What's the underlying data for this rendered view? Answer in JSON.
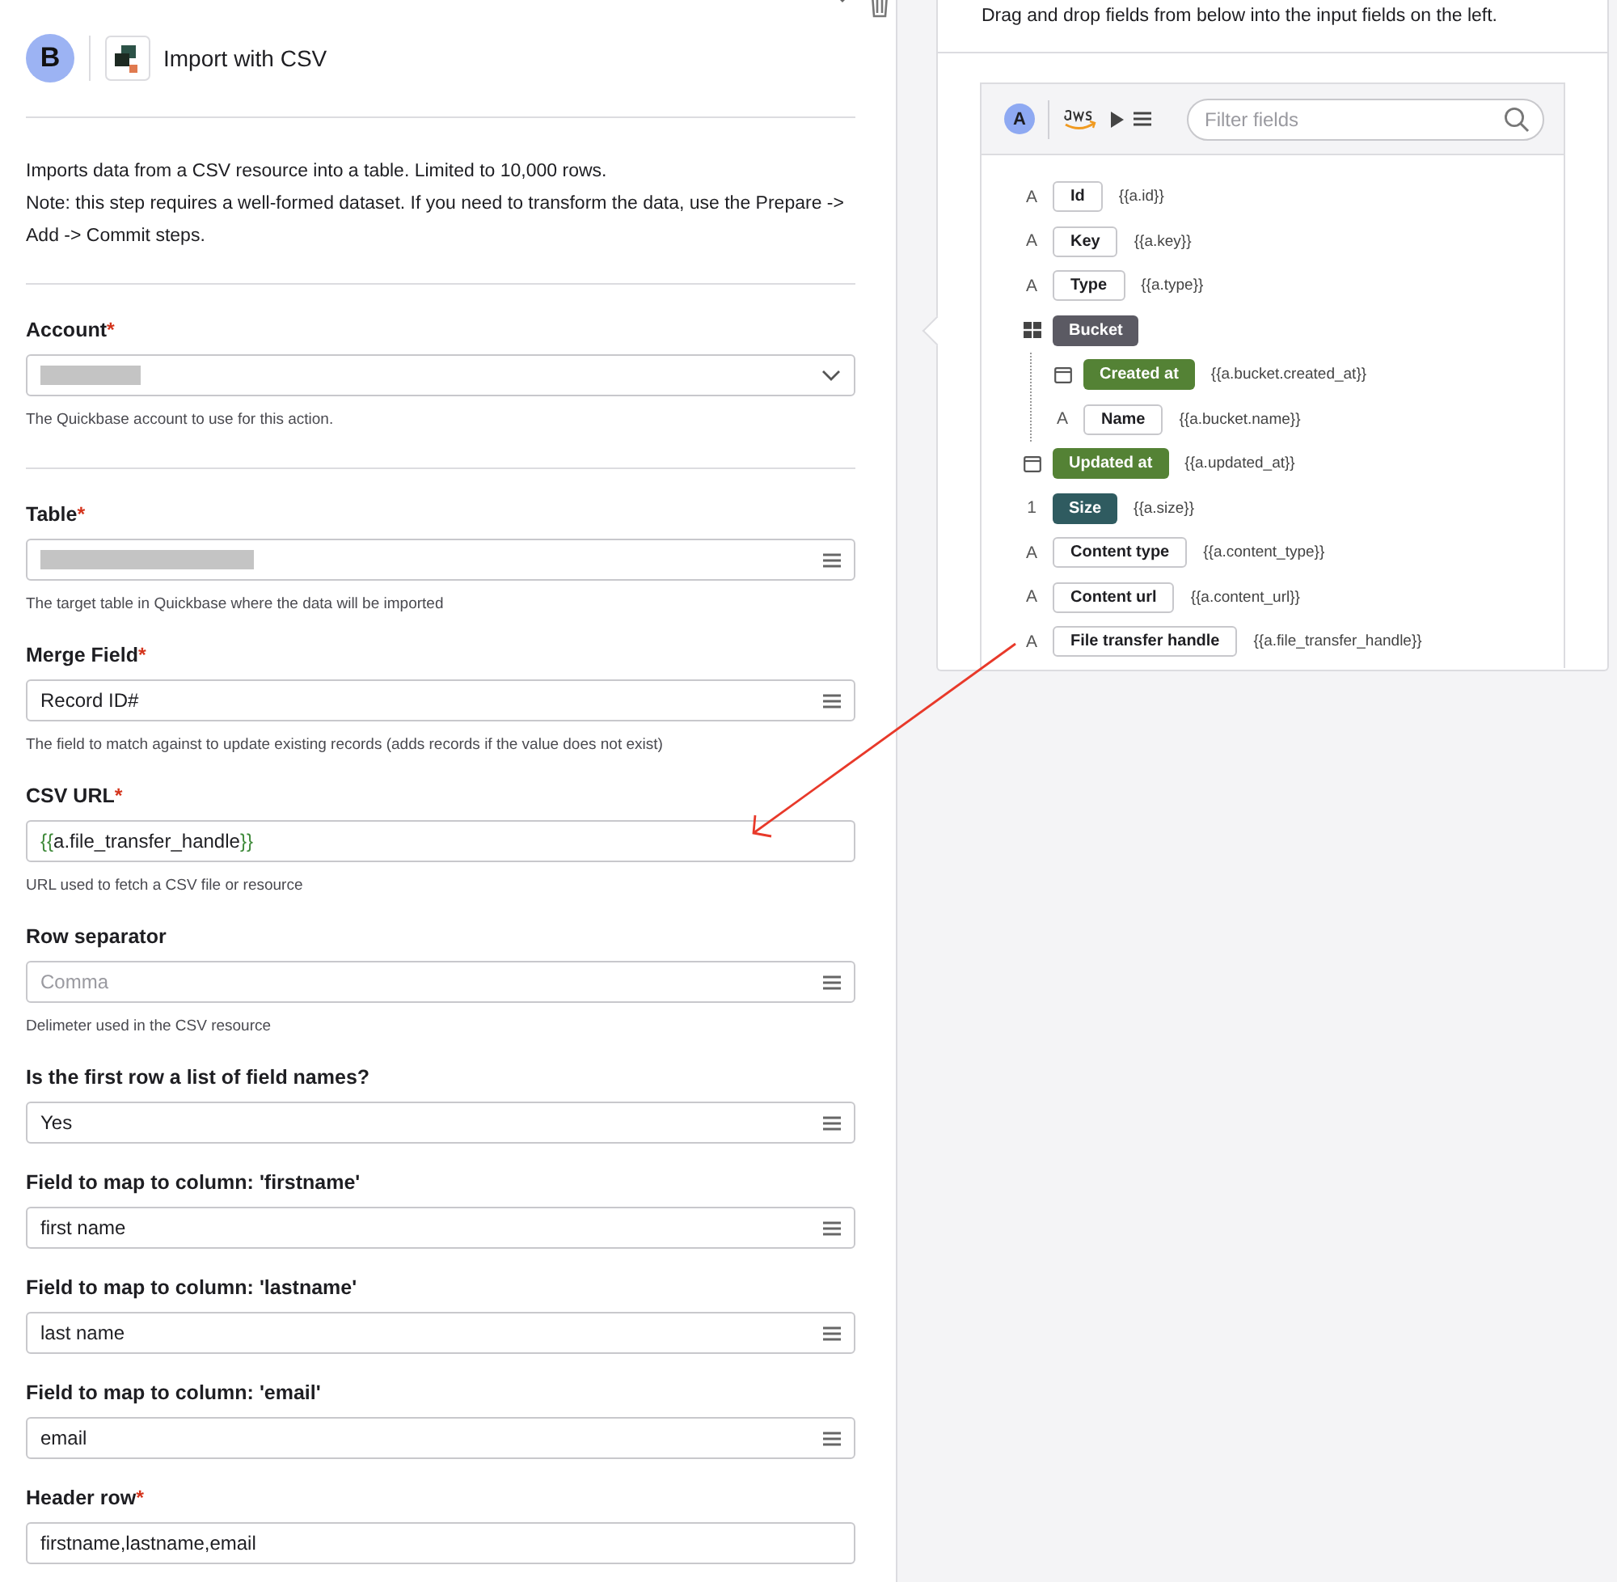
{
  "header": {
    "step_badge": "B",
    "title": "Import with CSV"
  },
  "description": [
    "Imports data from a CSV resource into a table. Limited to 10,000 rows.",
    "Note: this step requires a well-formed dataset. If you need to transform the data, use the Prepare -> Add -> Commit steps."
  ],
  "sections": [
    {
      "fields": [
        {
          "label": "Account",
          "required_mark": "*",
          "kind": "select",
          "redacted": true,
          "help": "The Quickbase account to use for this action."
        }
      ]
    },
    {
      "fields": [
        {
          "label": "Table",
          "required_mark": "*",
          "kind": "picker",
          "redacted": true,
          "help": "The target table in Quickbase where the data will be imported"
        },
        {
          "label": "Merge Field",
          "required_mark": "*",
          "kind": "picker",
          "value": "Record ID#",
          "help": "The field to match against to update existing records (adds records if the value does not exist)"
        },
        {
          "label": "CSV URL",
          "required_mark": "*",
          "kind": "text",
          "tokens": [
            {
              "kind": "brace",
              "text": "{{"
            },
            {
              "kind": "plain",
              "text": "a.file_transfer_handle"
            },
            {
              "kind": "brace",
              "text": "}}"
            }
          ],
          "help": "URL used to fetch a CSV file or resource"
        },
        {
          "label": "Row separator",
          "kind": "picker",
          "placeholder": "Comma",
          "help": "Delimeter used in the CSV resource"
        },
        {
          "label": "Is the first row a list of field names?",
          "kind": "picker",
          "value": "Yes"
        },
        {
          "label": "Field to map to column: 'firstname'",
          "kind": "picker",
          "value": "first name"
        },
        {
          "label": "Field to map to column: 'lastname'",
          "kind": "picker",
          "value": "last name"
        },
        {
          "label": "Field to map to column: 'email'",
          "kind": "picker",
          "value": "email"
        },
        {
          "label": "Header row",
          "required_mark": "*",
          "kind": "text",
          "value": "firstname,lastname,email"
        }
      ]
    }
  ],
  "fields_panel": {
    "instruction": "Drag and drop fields from below into the input fields on the left.",
    "source_badge": "A",
    "search": {
      "placeholder": "Filter fields"
    },
    "items": [
      {
        "kind": "text",
        "glyph": "A",
        "label": "Id",
        "color": "#ffffff",
        "template": "{{a.id}}"
      },
      {
        "kind": "text",
        "glyph": "A",
        "label": "Key",
        "color": "#ffffff",
        "template": "{{a.key}}"
      },
      {
        "kind": "text",
        "glyph": "A",
        "label": "Type",
        "color": "#ffffff",
        "template": "{{a.type}}"
      },
      {
        "kind": "group",
        "label": "Bucket",
        "color": "#5b5a63",
        "children": [
          {
            "kind": "date",
            "label": "Created at",
            "color": "#548235",
            "template": "{{a.bucket.created_at}}"
          },
          {
            "kind": "text",
            "glyph": "A",
            "label": "Name",
            "color": "#ffffff",
            "template": "{{a.bucket.name}}"
          }
        ]
      },
      {
        "kind": "date",
        "label": "Updated at",
        "color": "#548235",
        "template": "{{a.updated_at}}"
      },
      {
        "kind": "number",
        "glyph": "1",
        "label": "Size",
        "color": "#2f5b60",
        "template": "{{a.size}}"
      },
      {
        "kind": "text",
        "glyph": "A",
        "label": "Content type",
        "color": "#ffffff",
        "template": "{{a.content_type}}"
      },
      {
        "kind": "text",
        "glyph": "A",
        "label": "Content url",
        "color": "#ffffff",
        "template": "{{a.content_url}}"
      },
      {
        "kind": "text",
        "glyph": "A",
        "label": "File transfer handle",
        "color": "#ffffff",
        "template": "{{a.file_transfer_handle}}"
      }
    ]
  }
}
